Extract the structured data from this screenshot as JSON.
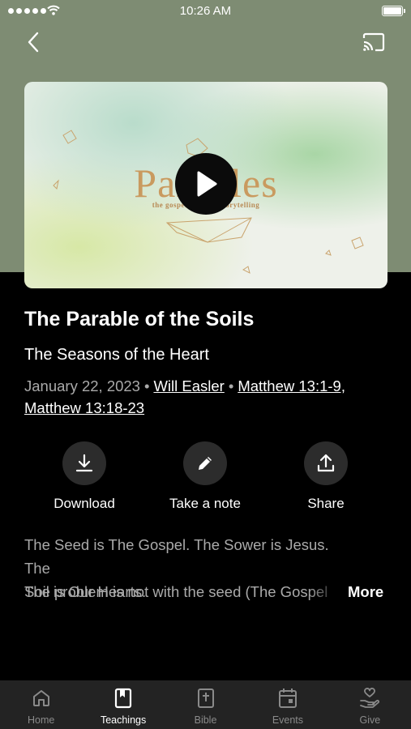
{
  "status_bar": {
    "time": "10:26 AM"
  },
  "hero": {
    "title_text": "Parables",
    "subtitle_text": "the gospel through storytelling"
  },
  "sermon": {
    "title": "The Parable of the Soils",
    "series": "The Seasons of the Heart",
    "date": "January 22, 2023",
    "speaker": "Will Easler",
    "scripture_1": "Matthew 13:1-9,",
    "scripture_2": "Matthew 13:18-23"
  },
  "actions": [
    {
      "label": "Download",
      "icon": "download-icon"
    },
    {
      "label": "Take a note",
      "icon": "pencil-icon"
    },
    {
      "label": "Share",
      "icon": "share-icon"
    }
  ],
  "description": {
    "line1": "The Seed is The Gospel. The Sower is Jesus. The",
    "line2": "Soil is Our Hearts.",
    "line3": "The problem is not with the seed (The Gospel",
    "more_label": "More"
  },
  "tabs": [
    {
      "label": "Home",
      "icon": "home-icon",
      "active": false
    },
    {
      "label": "Teachings",
      "icon": "book-icon",
      "active": true
    },
    {
      "label": "Bible",
      "icon": "bible-icon",
      "active": false
    },
    {
      "label": "Events",
      "icon": "calendar-icon",
      "active": false
    },
    {
      "label": "Give",
      "icon": "give-icon",
      "active": false
    }
  ],
  "colors": {
    "header_bg": "#7e8c73",
    "background": "#000000",
    "tabbar_bg": "#232323",
    "action_circle": "#2c2c2c",
    "muted_text": "#aaaaaa",
    "hero_gold": "#c99a5f"
  }
}
